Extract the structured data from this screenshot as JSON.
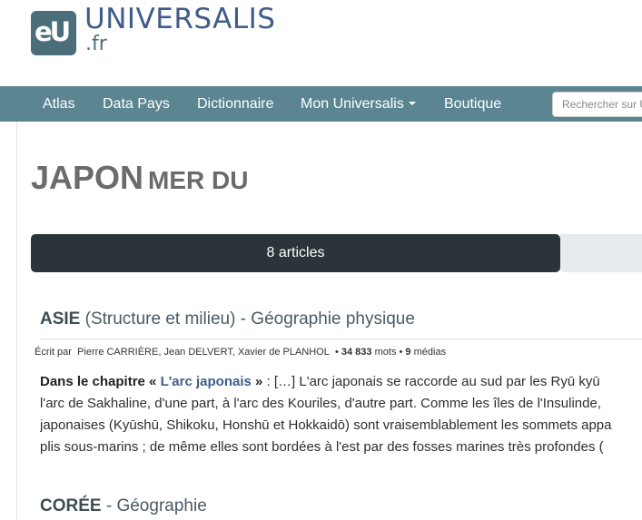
{
  "header": {
    "logo_mark": "eU",
    "logo_name": "UNIVERSALIS",
    "logo_tld": ".fr"
  },
  "nav": {
    "items": [
      {
        "label": "Atlas"
      },
      {
        "label": "Data Pays"
      },
      {
        "label": "Dictionnaire"
      },
      {
        "label": "Mon Universalis"
      },
      {
        "label": "Boutique"
      }
    ],
    "search_placeholder": "Rechercher sur Universalis"
  },
  "page": {
    "title_main": "JAPON",
    "title_sub": "MER DU"
  },
  "tabs": {
    "active_label": "8 articles"
  },
  "articles": [
    {
      "title_bold": "ASIE",
      "title_rest": " (Structure et milieu) - Géographie physique",
      "byline_prefix": "Écrit par",
      "authors": "Pierre CARRIÈRE,  Jean DELVERT,  Xavier de PLANHOL",
      "words_count": "34 833",
      "words_label": "mots",
      "medias_count": "9",
      "medias_label": "médias",
      "chapter_prefix": "Dans le chapitre «",
      "chapter_link": "L'arc japonais",
      "chapter_suffix": "»",
      "excerpt_lines": [
        " : […] L'arc japonais se raccorde au sud par les Ryū kyū",
        "l'arc de Sakhaline, d'une part, à l'arc des Kouriles, d'autre part. Comme les îles de l'Insulinde,",
        "japonaises (Kyūshū, Shikoku, Honshū et Hokkaidō) sont vraisemblablement les sommets appa",
        "plis sous-marins ; de même elles sont bordées à l'est par des fosses marines très profondes ("
      ]
    },
    {
      "title_bold": "CORÉE",
      "title_rest": " - Géographie"
    }
  ],
  "colors": {
    "navbar": "#5b8691",
    "tab_active": "#2a3439",
    "brand_blue": "#3f5c8a",
    "logo_teal": "#4a6e7a"
  }
}
